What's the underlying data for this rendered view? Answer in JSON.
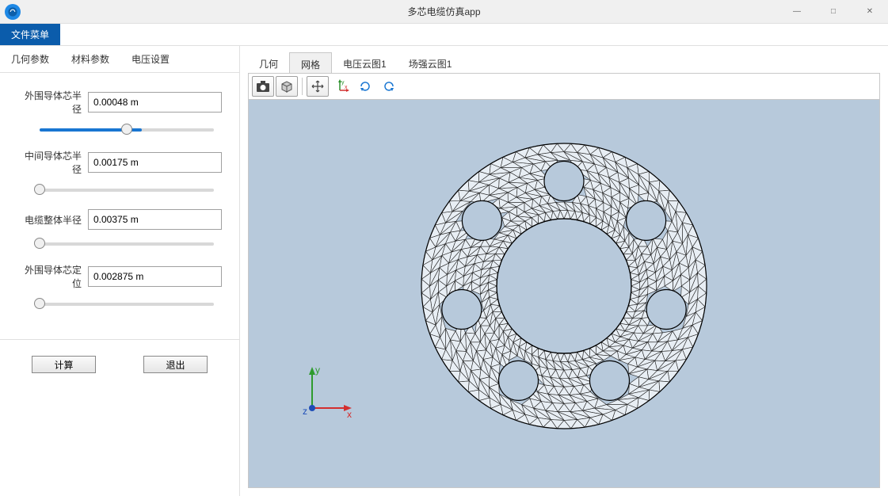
{
  "window": {
    "title": "多芯电缆仿真app",
    "minimize": "—",
    "maximize": "□",
    "close": "✕"
  },
  "menubar": {
    "file_menu": "文件菜单"
  },
  "param_tabs": [
    "几何参数",
    "材料参数",
    "电压设置"
  ],
  "params": [
    {
      "label": "外围导体芯半径",
      "value": "0.00048 m",
      "slider_pct": 50
    },
    {
      "label": "中间导体芯半径",
      "value": "0.00175 m",
      "slider_pct": 0
    },
    {
      "label": "电缆整体半径",
      "value": "0.00375 m",
      "slider_pct": 0
    },
    {
      "label": "外围导体芯定位",
      "value": "0.002875 m",
      "slider_pct": 0
    }
  ],
  "buttons": {
    "compute": "计算",
    "exit": "退出"
  },
  "view_tabs": [
    "几何",
    "网格",
    "电压云图1",
    "场强云图1"
  ],
  "view_tab_active": 1,
  "toolbar": {
    "screenshot": "screenshot-icon",
    "cube": "cube-icon",
    "pan": "pan-icon",
    "axes": "axes-icon",
    "rotate_cw": "rotate-cw-icon",
    "rotate_ccw": "rotate-ccw-icon"
  },
  "axes": {
    "x": "x",
    "y": "y",
    "z": "z"
  }
}
